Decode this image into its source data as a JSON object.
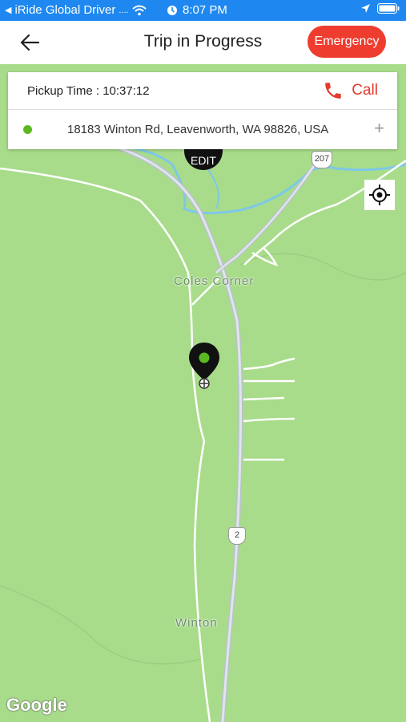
{
  "status_bar": {
    "back_app": "iRide Global Driver",
    "time": "8:07 PM"
  },
  "header": {
    "title": "Trip in Progress",
    "emergency_label": "Emergency"
  },
  "trip_card": {
    "pickup_time": "Pickup Time : 10:37:12",
    "call_label": "Call",
    "address": "18183 Winton Rd, Leavenworth, WA 98826, USA",
    "add_symbol": "+"
  },
  "map": {
    "edit_label": "EDIT",
    "places": [
      "Coles Corner",
      "Winton"
    ],
    "route_shields": [
      "207",
      "2"
    ],
    "attribution": "Google"
  },
  "colors": {
    "status_bar": "#1e88f0",
    "emergency": "#ee3d2f",
    "call": "#e33b2e",
    "pickup_dot": "#5cb822",
    "map_land": "#a8dc8a"
  }
}
